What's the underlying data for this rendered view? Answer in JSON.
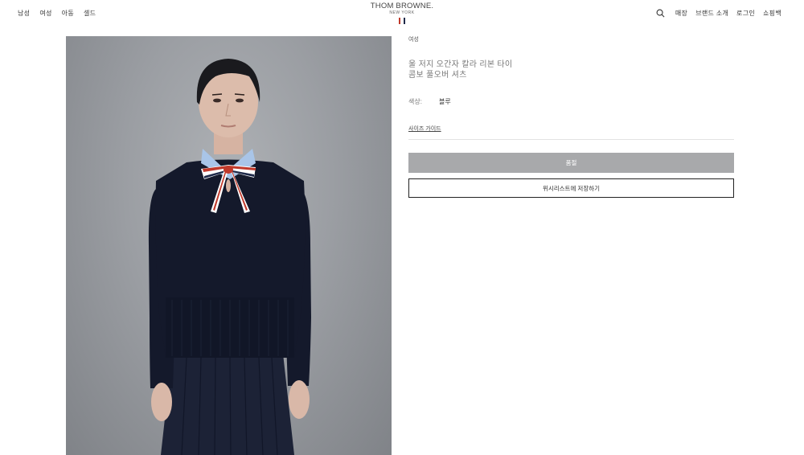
{
  "nav": {
    "left": [
      "남성",
      "여성",
      "아동",
      "셀드"
    ],
    "right": [
      "매장",
      "브랜드 소개",
      "로그인",
      "쇼핑백"
    ]
  },
  "logo": {
    "title": "THOM BROWNE.",
    "subtitle": "NEW YORK"
  },
  "product": {
    "category": "여성",
    "title_line1": "울 저지 오간자 칼라 리본 타이",
    "title_line2": "콤보 풀오버 셔츠",
    "color_label": "색상:",
    "color_value": "블루",
    "size_guide": "사이즈 가이드",
    "sold_out_label": "품절",
    "wishlist_label": "위시리스트에 저장하기"
  },
  "colors": {
    "stripe_red": "#c0392b",
    "stripe_white": "#ffffff",
    "stripe_navy": "#1f2a4a",
    "sweater_navy": "#14192b"
  }
}
